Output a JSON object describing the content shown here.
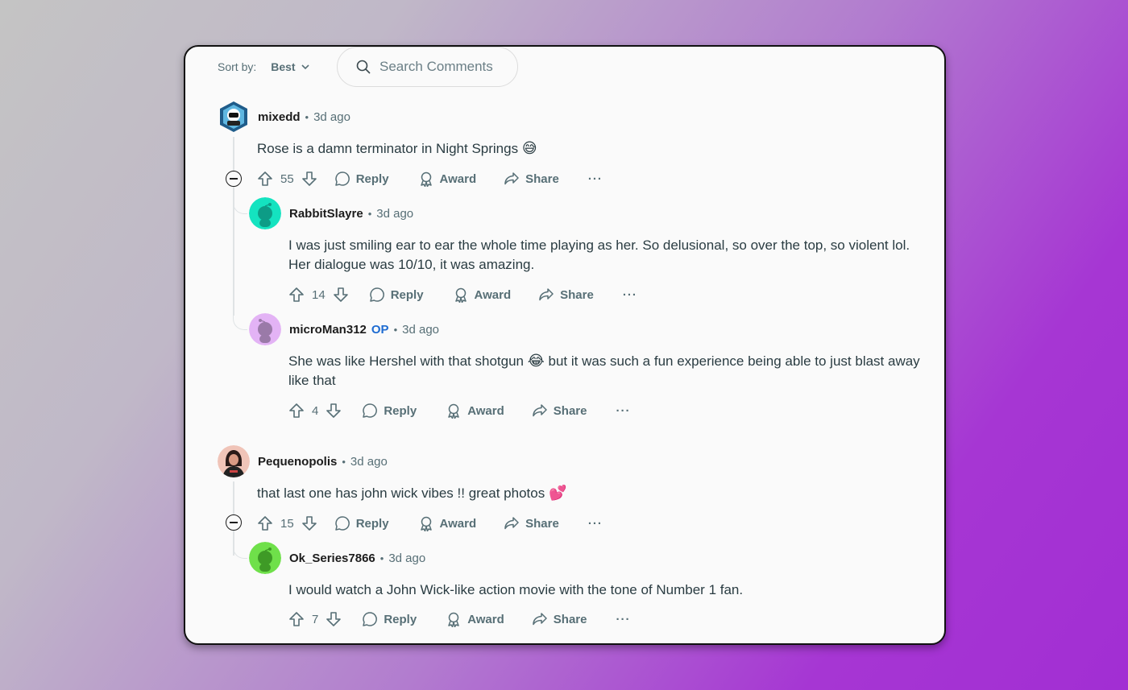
{
  "toolbar": {
    "sort_label": "Sort by:",
    "sort_value": "Best",
    "search_placeholder": "Search Comments"
  },
  "comments": [
    {
      "username": "mixedd",
      "time": "3d ago",
      "text": "Rose is a damn terminator in Night Springs",
      "emoji": "😅",
      "score": "55",
      "reply": "Reply",
      "award": "Award",
      "share": "Share",
      "more": "···",
      "replies": [
        {
          "username": "RabbitSlayre",
          "time": "3d ago",
          "text": "I was just smiling ear to ear the whole time playing as her. So delusional, so over the top, so violent lol. Her dialogue was 10/10, it was amazing.",
          "score": "14",
          "reply": "Reply",
          "award": "Award",
          "share": "Share",
          "more": "···"
        },
        {
          "username": "microMan312",
          "op": "OP",
          "time": "3d ago",
          "text_before": "She was like Hershel with that shotgun",
          "emoji": "😂",
          "text_after": "but it was such a fun experience being able to just blast away like that",
          "score": "4",
          "reply": "Reply",
          "award": "Award",
          "share": "Share",
          "more": "···"
        }
      ]
    },
    {
      "username": "Pequenopolis",
      "time": "3d ago",
      "text": "that last one has john wick vibes !! great photos",
      "emoji": "💕",
      "score": "15",
      "reply": "Reply",
      "award": "Award",
      "share": "Share",
      "more": "···",
      "replies": [
        {
          "username": "Ok_Series7866",
          "time": "3d ago",
          "text": "I would watch a John Wick-like action movie with the tone of Number 1 fan.",
          "score": "7",
          "reply": "Reply",
          "award": "Award",
          "share": "Share",
          "more": "···"
        }
      ]
    }
  ],
  "colors": {
    "text_muted": "#576f76",
    "op_blue": "#1d6bd1",
    "avatar_rabbit": "#14e3c0",
    "avatar_micro": "#d9a3f0",
    "avatar_ok": "#6fe04a"
  }
}
